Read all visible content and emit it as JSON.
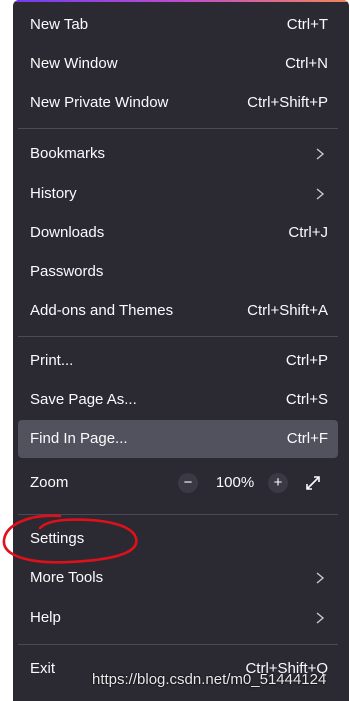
{
  "menu": {
    "items": [
      {
        "label": "New Tab",
        "shortcut": "Ctrl+T"
      },
      {
        "label": "New Window",
        "shortcut": "Ctrl+N"
      },
      {
        "label": "New Private Window",
        "shortcut": "Ctrl+Shift+P"
      },
      {
        "label": "Bookmarks"
      },
      {
        "label": "History"
      },
      {
        "label": "Downloads",
        "shortcut": "Ctrl+J"
      },
      {
        "label": "Passwords"
      },
      {
        "label": "Add-ons and Themes",
        "shortcut": "Ctrl+Shift+A"
      },
      {
        "label": "Print...",
        "shortcut": "Ctrl+P"
      },
      {
        "label": "Save Page As...",
        "shortcut": "Ctrl+S"
      },
      {
        "label": "Find In Page...",
        "shortcut": "Ctrl+F"
      },
      {
        "label": "Settings"
      },
      {
        "label": "More Tools"
      },
      {
        "label": "Help"
      },
      {
        "label": "Exit",
        "shortcut": "Ctrl+Shift+Q"
      }
    ],
    "zoom": {
      "label": "Zoom",
      "minus": "−",
      "value": "100%",
      "plus": "+"
    }
  },
  "watermark": "https://blog.csdn.net/m0_51444124",
  "colors": {
    "menu_bg": "#2b2a33",
    "hover_bg": "#52525e",
    "text": "#fbfbfe",
    "annotation": "#e0101a"
  }
}
